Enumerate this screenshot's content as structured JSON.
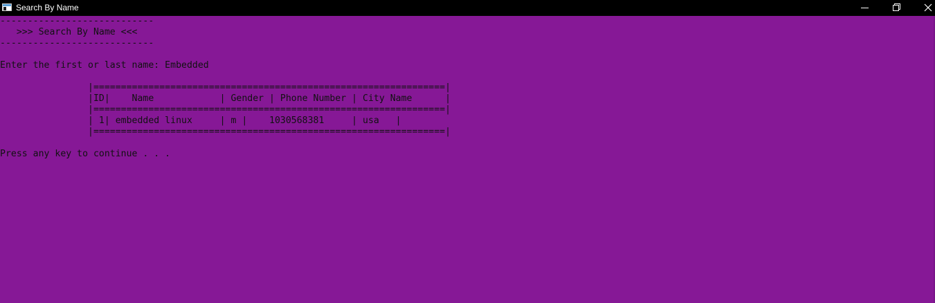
{
  "window": {
    "title": "Search By Name",
    "background_color": "#861896",
    "titlebar_color": "#000000",
    "text_color": "#111111"
  },
  "titlebar_controls": {
    "minimize_icon": "minimize-icon",
    "restore_icon": "restore-icon",
    "close_icon": "close-icon"
  },
  "console": {
    "lines": [
      "----------------------------",
      "   >>> Search By Name <<<",
      "----------------------------",
      "",
      "Enter the first or last name: Embedded",
      "",
      "                |================================================================|",
      "                |ID|    Name            | Gender | Phone Number | City Name      |",
      "                |================================================================|",
      "                | 1| embedded linux     | m |    1030568381     | usa   |",
      "                |================================================================|",
      "",
      "Press any key to continue . . ."
    ]
  }
}
